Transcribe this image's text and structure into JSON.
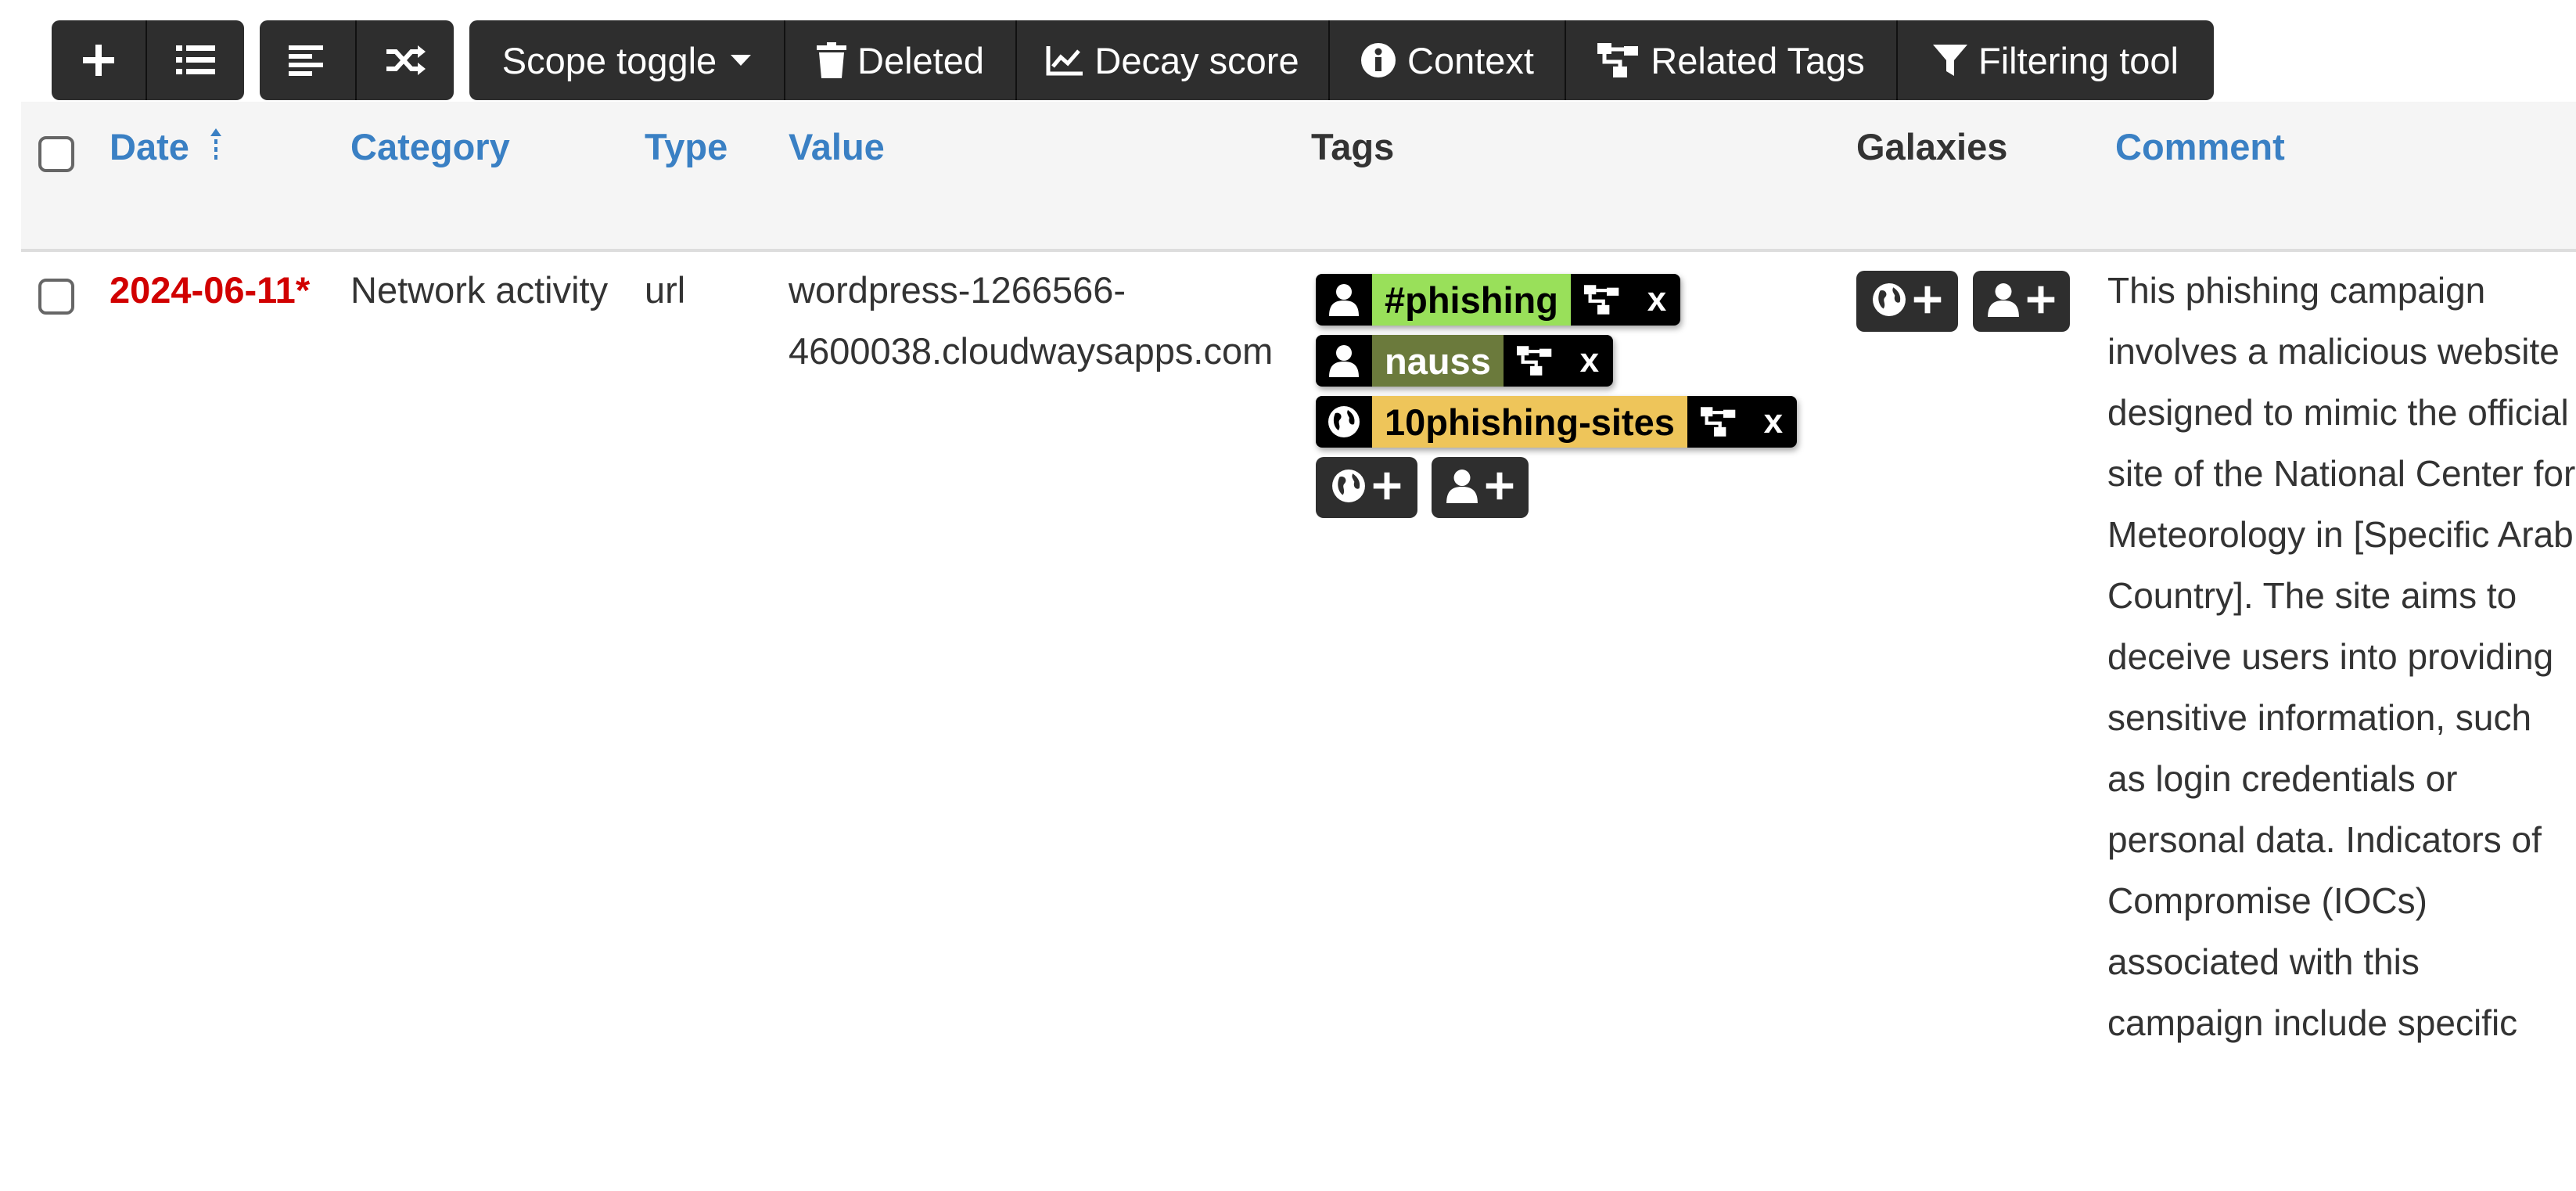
{
  "toolbar": {
    "scope_toggle": "Scope toggle",
    "deleted": "Deleted",
    "decay_score": "Decay score",
    "context": "Context",
    "related_tags": "Related Tags",
    "filtering_tool": "Filtering tool"
  },
  "columns": {
    "date": "Date",
    "category": "Category",
    "type": "Type",
    "value": "Value",
    "tags": "Tags",
    "galaxies": "Galaxies",
    "comment": "Comment"
  },
  "row": {
    "date": "2024-06-11*",
    "category": "Network activity",
    "type": "url",
    "value_line1": "wordpress-1266566-",
    "value_line2": "4600038.cloudwaysapps.com",
    "tags": [
      {
        "name": "#phishing",
        "bg": "#99e05a",
        "fg": "#000000",
        "icon": "user-icon"
      },
      {
        "name": "nauss",
        "bg": "#6b7a3c",
        "fg": "#ffffff",
        "icon": "user-icon"
      },
      {
        "name": "10phishing-sites",
        "bg": "#eec55a",
        "fg": "#000000",
        "icon": "globe-icon"
      }
    ],
    "tag_remove": "x",
    "comment": "This phishing campaign involves a malicious website designed to mimic the official site of the National Center for Meteorology in [Specific Arab Country]. The site aims to deceive users into providing sensitive information, such as login credentials or personal data. Indicators of Compromise (IOCs) associated with this campaign include specific"
  },
  "colors": {
    "toolbar_bg": "#2e2e2e",
    "link": "#3a80c4",
    "date": "#d10000"
  }
}
